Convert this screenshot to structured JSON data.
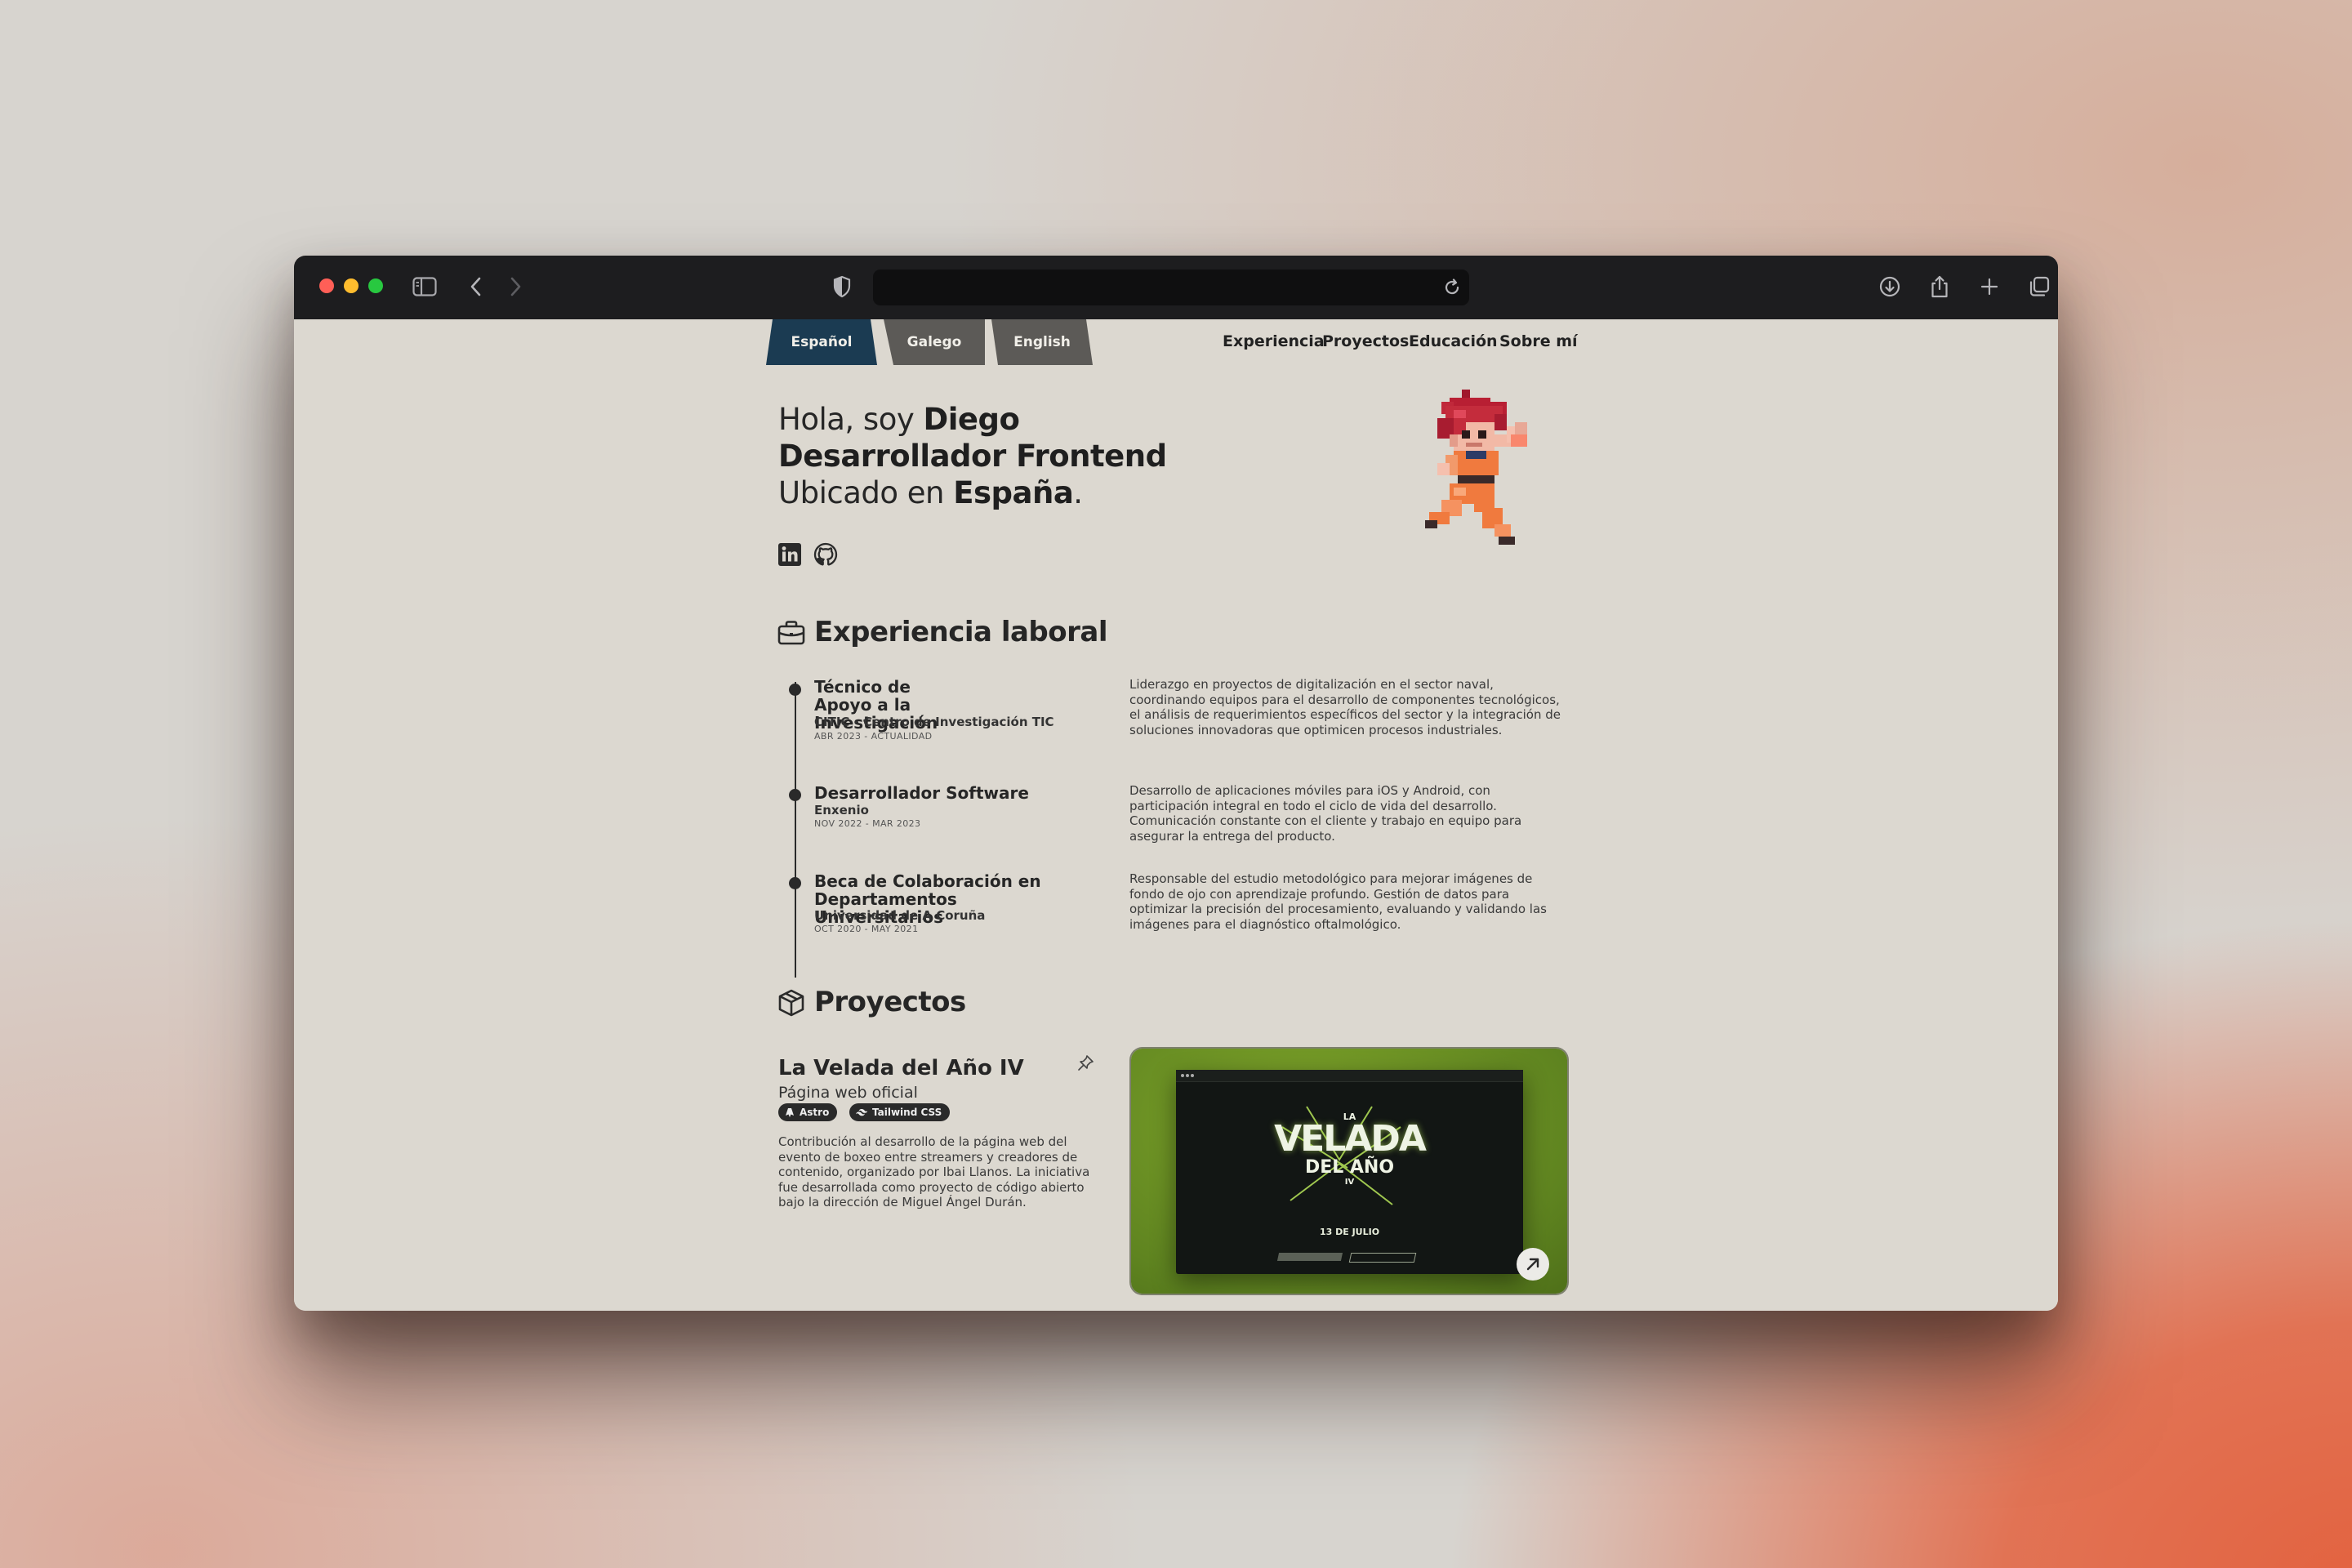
{
  "browser": {
    "address_value": "",
    "colors": {
      "close": "#ff5f57",
      "minimize": "#febc2e",
      "zoom": "#28c840"
    }
  },
  "languages": [
    {
      "label": "Español",
      "active": true
    },
    {
      "label": "Galego",
      "active": false
    },
    {
      "label": "English",
      "active": false
    }
  ],
  "nav": {
    "experience": "Experiencia",
    "projects": "Proyectos",
    "education": "Educación",
    "about": "Sobre mí"
  },
  "hero": {
    "greeting": "Hola, soy ",
    "name": "Diego",
    "role": "Desarrollador Frontend",
    "location_prefix": "Ubicado en ",
    "location": "España",
    "period": "."
  },
  "social": [
    "linkedin-icon",
    "github-icon"
  ],
  "experience": {
    "title": "Experiencia laboral",
    "jobs": [
      {
        "title": "Técnico de Apoyo a la Investigación",
        "company": "CITIC - Centro de Investigación TIC",
        "date": "ABR 2023 - ACTUALIDAD",
        "description": "Liderazgo en proyectos de digitalización en el sector naval, coordinando equipos para el desarrollo de componentes tecnológicos, el análisis de requerimientos específicos del sector y la integración de soluciones innovadoras que optimicen procesos industriales."
      },
      {
        "title": "Desarrollador Software",
        "company": "Enxenio",
        "date": "NOV 2022 - MAR 2023",
        "description": "Desarrollo de aplicaciones móviles para iOS y Android, con participación integral en todo el ciclo de vida del desarrollo. Comunicación constante con el cliente y trabajo en equipo para asegurar la entrega del producto."
      },
      {
        "title": "Beca de Colaboración en Departamentos Universitarios",
        "company": "Universidad de A Coruña",
        "date": "OCT 2020 - MAY 2021",
        "description": "Responsable del estudio metodológico para mejorar imágenes de fondo de ojo con aprendizaje profundo. Gestión de datos para optimizar la precisión del procesamiento, evaluando y validando las imágenes para el diagnóstico oftalmológico."
      }
    ]
  },
  "projects": {
    "title": "Proyectos",
    "items": [
      {
        "title": "La Velada del Año IV",
        "subtitle": "Página web oficial",
        "tags": [
          "Astro",
          "Tailwind CSS"
        ],
        "description": "Contribución al desarrollo de la página web del evento de boxeo entre streamers y creadores de contenido, organizado por Ibai Llanos. La iniciativa fue desarrollada como proyecto de código abierto bajo la dirección de Miguel Ángel Durán.",
        "preview": {
          "line1": "LA",
          "line2": "VELADA",
          "line3": "DEL AÑO",
          "line4": "IV",
          "date": "13 DE JULIO"
        }
      }
    ]
  }
}
